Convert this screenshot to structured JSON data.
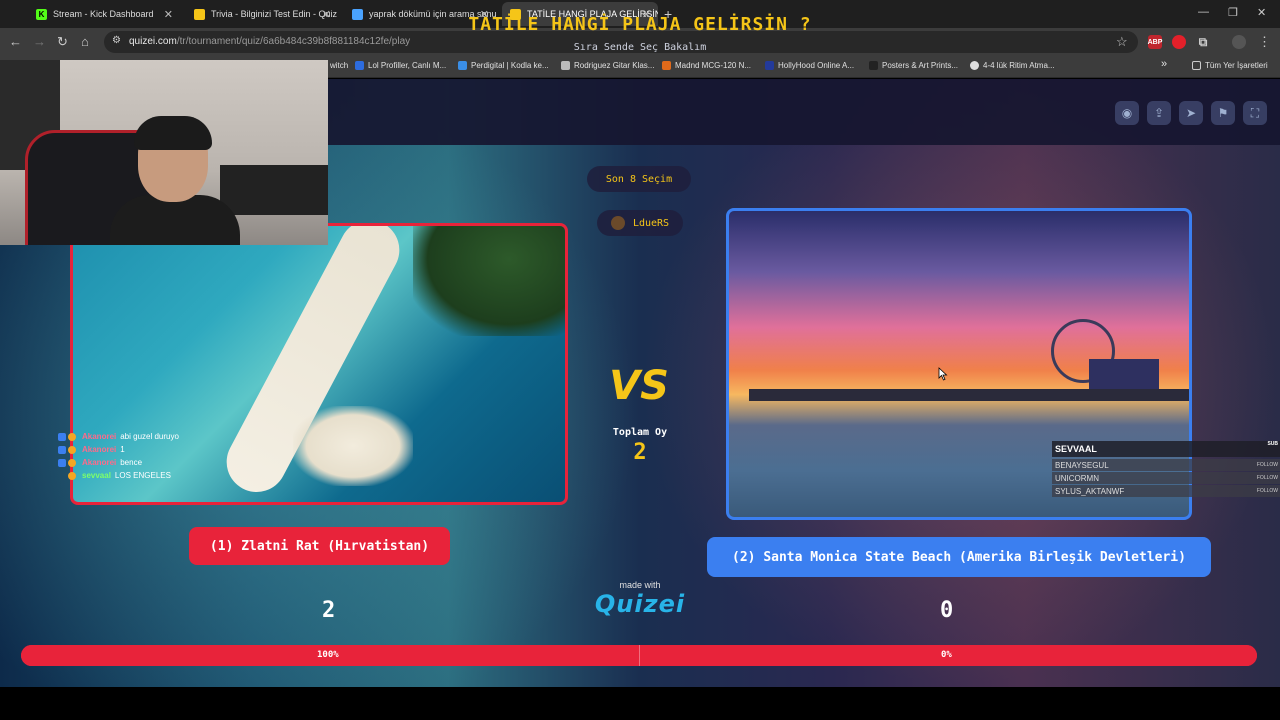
{
  "browser": {
    "tabs": [
      {
        "title": "Stream - Kick Dashboard",
        "icon": "kick-icon",
        "color": "#53fc18"
      },
      {
        "title": "Trivia - Bilginizi Test Edin - Quiz",
        "icon": "quiz-icon",
        "color": "#f5c518"
      },
      {
        "title": "yaprak dökümü için arama sonu",
        "icon": "search-icon",
        "color": "#4aa3ff"
      },
      {
        "title": "TATİLE HANGİ PLAJA GELİRSİN",
        "icon": "quiz-icon",
        "color": "#f5c518"
      }
    ],
    "active_tab_index": 3,
    "url_host": "quizei.com",
    "url_path": "/tr/tournament/quiz/6a6b484c39b8f881184c12fe/play",
    "bookmarks": [
      "witch",
      "Lol Profiller, Canlı M...",
      "Perdigital | Kodla ke...",
      "Rodriguez Gitar Klas...",
      "Madnd MCG-120 N...",
      "HollyHood Online A...",
      "Posters & Art Prints...",
      "4-4 lük Ritim Atma..."
    ],
    "bookmarks_overflow": "»",
    "all_bookmarks": "Tüm Yer İşaretleri"
  },
  "quiz": {
    "title": "TATİLE HANGİ PLAJA GELİRSİN ?",
    "subtitle": "Sıra Sende Seç Bakalım",
    "round": "Son 8 Seçim",
    "player": "LdueRS",
    "vs": "VS",
    "total_votes_label": "Toplam Oy",
    "total_votes": "2",
    "options": [
      {
        "label": "(1) Zlatni Rat (Hırvatistan)",
        "votes": "2",
        "percent": "100%",
        "color": "#e8233a"
      },
      {
        "label": "(2) Santa Monica State Beach (Amerika Birleşik Devletleri)",
        "votes": "0",
        "percent": "0%",
        "color": "#3b7ff0"
      }
    ],
    "made_with": "made with",
    "brand": "Quizei",
    "progress_left_fraction": 1.0
  },
  "chat": [
    {
      "user": "Akanorei",
      "msg": "abi guzel duruyo",
      "color": "#ff6a8a"
    },
    {
      "user": "Akanorei",
      "msg": "1",
      "color": "#ff6a8a"
    },
    {
      "user": "Akanorei",
      "msg": "bence",
      "color": "#ff6a8a"
    },
    {
      "user": "sevvaal",
      "msg": "LOS ENGELES",
      "color": "#7dff6a"
    }
  ],
  "followers": {
    "header": "SEVVAAL",
    "header_tag": "SUB",
    "list": [
      {
        "name": "BENAYSEGUL",
        "tag": "FOLLOW"
      },
      {
        "name": "UNICORMN",
        "tag": "FOLLOW"
      },
      {
        "name": "SYLUS_AKTANWF",
        "tag": "FOLLOW"
      }
    ]
  }
}
